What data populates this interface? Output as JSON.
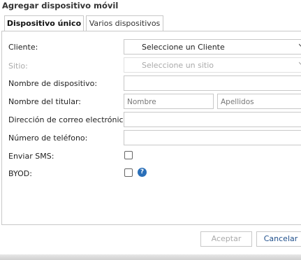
{
  "dialog": {
    "title": "Agregar dispositivo móvil"
  },
  "tabs": [
    {
      "label": "Dispositivo único",
      "active": true
    },
    {
      "label": "Varios dispositivos",
      "active": false
    }
  ],
  "form": {
    "client_label": "Cliente:",
    "client_value": "Seleccione un Cliente",
    "site_label": "Sitio:",
    "site_value": "Seleccione un sitio",
    "device_name_label": "Nombre de dispositivo:",
    "device_name_value": "",
    "holder_label": "Nombre del titular:",
    "first_name_placeholder": "Nombre",
    "last_name_placeholder": "Apellidos",
    "email_label": "Dirección de correo electrónico:",
    "email_value": "",
    "phone_label": "Número de teléfono:",
    "phone_value": "",
    "sms_label": "Enviar SMS:",
    "sms_checked": false,
    "byod_label": "BYOD:",
    "byod_checked": false,
    "help_glyph": "?"
  },
  "buttons": {
    "accept": "Aceptar",
    "cancel": "Cancelar"
  },
  "icons": {
    "dropdown": "chevron-down-icon",
    "help": "help-icon"
  },
  "colors": {
    "help_icon": "#2a6fb8",
    "cancel_text": "#1f4f8b",
    "disabled_text": "#aaaaaa"
  }
}
